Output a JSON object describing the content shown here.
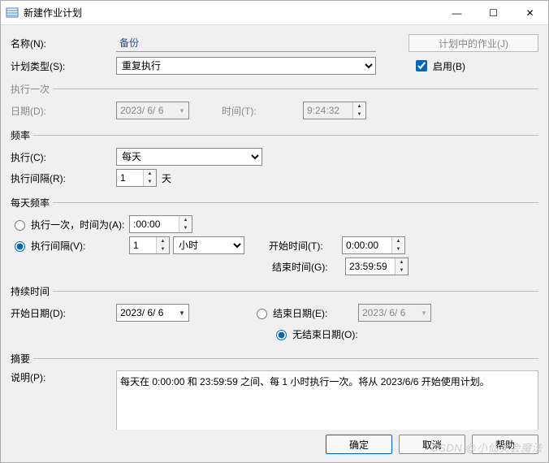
{
  "window": {
    "title": "新建作业计划",
    "min": "—",
    "max": "☐",
    "close": "✕"
  },
  "name": {
    "label": "名称(N):",
    "value": "备份"
  },
  "jobs_button": "计划中的作业(J)",
  "plan_type": {
    "label": "计划类型(S):",
    "value": "重复执行"
  },
  "enable": {
    "label": "启用(B)"
  },
  "once": {
    "legend": "执行一次",
    "date_label": "日期(D):",
    "date_value": "2023/ 6/ 6",
    "time_label": "时间(T):",
    "time_value": "9:24:32"
  },
  "freq": {
    "legend": "频率",
    "exec_label": "执行(C):",
    "exec_value": "每天",
    "interval_label": "执行间隔(R):",
    "interval_value": "1",
    "interval_unit": "天"
  },
  "daily": {
    "legend": "每天频率",
    "once_label": "执行一次，时间为(A):",
    "once_time": ":00:00",
    "interval_label": "执行间隔(V):",
    "interval_value": "1",
    "interval_unit": "小时",
    "start_label": "开始时间(T):",
    "start_value": "0:00:00",
    "end_label": "结束时间(G):",
    "end_value": "23:59:59"
  },
  "duration": {
    "legend": "持续时间",
    "start_label": "开始日期(D):",
    "start_value": "2023/ 6/ 6",
    "end_label": "结束日期(E):",
    "end_value": "2023/ 6/ 6",
    "noend_label": "无结束日期(O):"
  },
  "summary": {
    "legend": "摘要",
    "desc_label": "说明(P):",
    "desc_value": "每天在 0:00:00 和 23:59:59 之间、每 1 小时执行一次。将从 2023/6/6 开始使用计划。"
  },
  "buttons": {
    "ok": "确定",
    "cancel": "取消",
    "help": "帮助"
  },
  "watermark": "CSDN @小仙女会魔法"
}
